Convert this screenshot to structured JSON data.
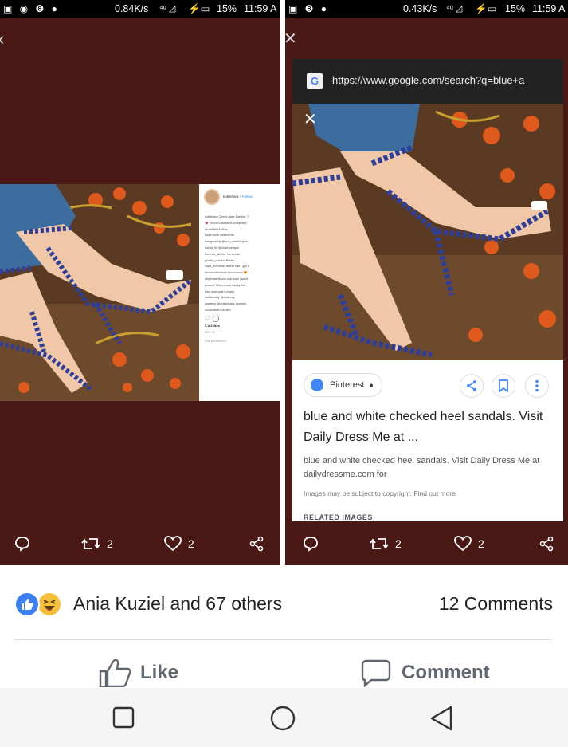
{
  "left_panel": {
    "status": {
      "speed": "0.84K/s",
      "battery": "15%",
      "time": "11:59 A"
    },
    "actions": {
      "retweets": "2",
      "likes": "2"
    },
    "instagram": {
      "username": "kobikhara",
      "follow": "• Follow",
      "lines": [
        "kobikhara Check Mate Darling 🤍",
        "💗 #ShoeObsessed #StepStep",
        "#KobiWithAnEye",
        "Load more comments",
        "wangechiiiiy @sue_mashin jeez",
        "kuhila_fnf @cicichoetique",
        "florence_kibebe No words",
        "ghattie_chacha Pretty",
        "hope_kei Wow. where can I get t",
        "fierceicollections Woooooow 😍",
        "niejemas Mama mia wow I want",
        "gmunai This comes handy this",
        "john.sper swit n lovely",
        "anitahbaby @audzeey",
        "audzeey @anitahbaby awhhhh",
        "nicawittimii Kill us!!!"
      ],
      "likes": "5,163 likes",
      "date": "MAY 20",
      "add_comment": "Add a comment..."
    }
  },
  "right_panel": {
    "status": {
      "speed": "0.43K/s",
      "battery": "15%",
      "time": "11:59 A"
    },
    "url": "https://www.google.com/search?q=blue+a",
    "source": "Pinterest",
    "title": "blue and white checked heel sandals. Visit Daily Dress Me at ...",
    "description": "blue and white checked heel sandals. Visit Daily Dress Me at dailydressme.com for",
    "copyright": "Images may be subject to copyright. Find out more",
    "related": "RELATED IMAGES",
    "actions": {
      "retweets": "2",
      "likes": "2"
    }
  },
  "reactions": {
    "names": "Ania Kuziel and 67 others",
    "comments": "12 Comments"
  },
  "buttons": {
    "like": "Like",
    "comment": "Comment"
  },
  "colors": {
    "panel_bg": "#4a1916",
    "fb_blue": "#3b7ff4",
    "text_gray": "#606770"
  }
}
